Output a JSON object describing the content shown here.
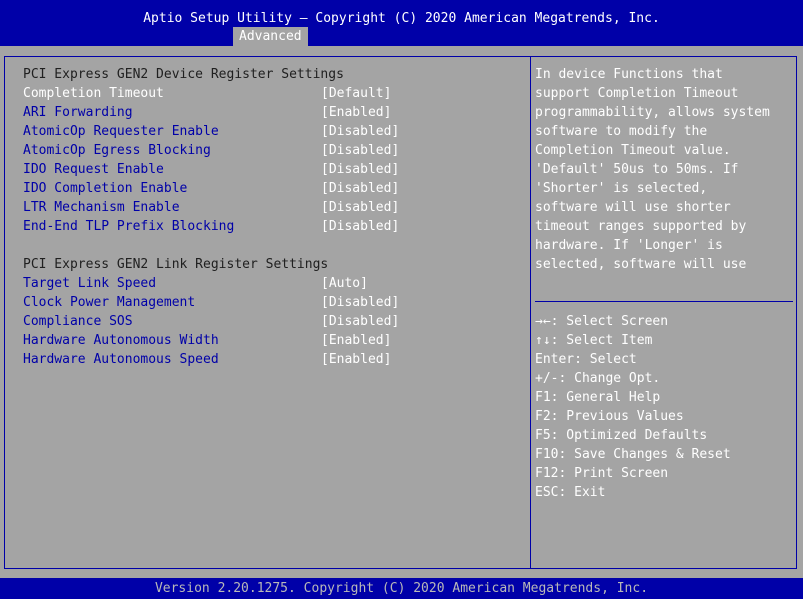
{
  "header": {
    "title": "Aptio Setup Utility – Copyright (C) 2020 American Megatrends, Inc.",
    "active_tab": "Advanced"
  },
  "device_section": {
    "title": "PCI Express GEN2 Device Register Settings",
    "items": [
      {
        "label": "Completion Timeout",
        "value": "[Default]"
      },
      {
        "label": "ARI Forwarding",
        "value": "[Enabled]"
      },
      {
        "label": "AtomicOp Requester Enable",
        "value": "[Disabled]"
      },
      {
        "label": "AtomicOp Egress Blocking",
        "value": "[Disabled]"
      },
      {
        "label": "IDO Request Enable",
        "value": "[Disabled]"
      },
      {
        "label": "IDO Completion Enable",
        "value": "[Disabled]"
      },
      {
        "label": "LTR Mechanism Enable",
        "value": "[Disabled]"
      },
      {
        "label": "End-End TLP Prefix Blocking",
        "value": "[Disabled]"
      }
    ]
  },
  "link_section": {
    "title": "PCI Express GEN2 Link Register Settings",
    "items": [
      {
        "label": "Target Link Speed",
        "value": "[Auto]"
      },
      {
        "label": "Clock Power Management",
        "value": "[Disabled]"
      },
      {
        "label": "Compliance SOS",
        "value": "[Disabled]"
      },
      {
        "label": "Hardware Autonomous Width",
        "value": "[Enabled]"
      },
      {
        "label": "Hardware Autonomous Speed",
        "value": "[Enabled]"
      }
    ]
  },
  "help": {
    "lines": [
      "In device Functions that",
      "support Completion Timeout",
      "programmability, allows system",
      "software to modify the",
      "Completion Timeout value.",
      "'Default' 50us to 50ms. If",
      "'Shorter' is selected,",
      "software will use shorter",
      "timeout ranges supported by",
      "hardware. If 'Longer' is",
      "selected, software will use"
    ]
  },
  "keys": [
    "→←: Select Screen",
    "↑↓: Select Item",
    "Enter: Select",
    "+/-: Change Opt.",
    "F1: General Help",
    "F2: Previous Values",
    "F5: Optimized Defaults",
    "F10: Save Changes & Reset",
    "F12: Print Screen",
    "ESC: Exit"
  ],
  "footer": {
    "text": "Version 2.20.1275. Copyright (C) 2020 American Megatrends, Inc."
  },
  "colors": {
    "background": "#a4a4a4",
    "header_blue": "#0000a8",
    "label_blue": "#0000a8",
    "value_white": "#ffffff"
  }
}
